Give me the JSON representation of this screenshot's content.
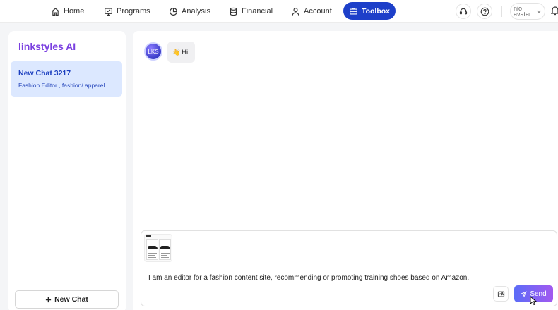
{
  "nav": {
    "home": "Home",
    "programs": "Programs",
    "analysis": "Analysis",
    "financial": "Financial",
    "account": "Account",
    "toolbox": "Toolbox",
    "avatar_alt": "nio avatar"
  },
  "sidebar": {
    "brand": "linkstyles AI",
    "chats": [
      {
        "title": "New Chat 3217",
        "subtitle": "Fashion Editor , fashion/ apparel"
      }
    ],
    "new_chat_label": "New Chat"
  },
  "chat": {
    "bot_avatar": "LKS",
    "messages": [
      {
        "emoji": "👋",
        "text": "Hi!"
      }
    ]
  },
  "composer": {
    "prompt": "I am an editor for a fashion content site, recommending or promoting training shoes based on Amazon.",
    "send_label": "Send"
  },
  "colors": {
    "accent": "#1d3fc9",
    "brand": "#7a3fe0",
    "selected_chat": "#dce8ff"
  }
}
